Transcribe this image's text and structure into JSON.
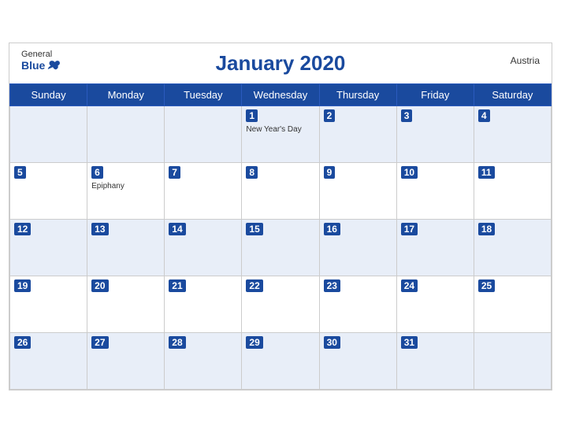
{
  "header": {
    "logo_general": "General",
    "logo_blue": "Blue",
    "title": "January 2020",
    "country": "Austria"
  },
  "days_of_week": [
    "Sunday",
    "Monday",
    "Tuesday",
    "Wednesday",
    "Thursday",
    "Friday",
    "Saturday"
  ],
  "weeks": [
    [
      {
        "day": "",
        "holiday": ""
      },
      {
        "day": "",
        "holiday": ""
      },
      {
        "day": "",
        "holiday": ""
      },
      {
        "day": "1",
        "holiday": "New Year's Day"
      },
      {
        "day": "2",
        "holiday": ""
      },
      {
        "day": "3",
        "holiday": ""
      },
      {
        "day": "4",
        "holiday": ""
      }
    ],
    [
      {
        "day": "5",
        "holiday": ""
      },
      {
        "day": "6",
        "holiday": "Epiphany"
      },
      {
        "day": "7",
        "holiday": ""
      },
      {
        "day": "8",
        "holiday": ""
      },
      {
        "day": "9",
        "holiday": ""
      },
      {
        "day": "10",
        "holiday": ""
      },
      {
        "day": "11",
        "holiday": ""
      }
    ],
    [
      {
        "day": "12",
        "holiday": ""
      },
      {
        "day": "13",
        "holiday": ""
      },
      {
        "day": "14",
        "holiday": ""
      },
      {
        "day": "15",
        "holiday": ""
      },
      {
        "day": "16",
        "holiday": ""
      },
      {
        "day": "17",
        "holiday": ""
      },
      {
        "day": "18",
        "holiday": ""
      }
    ],
    [
      {
        "day": "19",
        "holiday": ""
      },
      {
        "day": "20",
        "holiday": ""
      },
      {
        "day": "21",
        "holiday": ""
      },
      {
        "day": "22",
        "holiday": ""
      },
      {
        "day": "23",
        "holiday": ""
      },
      {
        "day": "24",
        "holiday": ""
      },
      {
        "day": "25",
        "holiday": ""
      }
    ],
    [
      {
        "day": "26",
        "holiday": ""
      },
      {
        "day": "27",
        "holiday": ""
      },
      {
        "day": "28",
        "holiday": ""
      },
      {
        "day": "29",
        "holiday": ""
      },
      {
        "day": "30",
        "holiday": ""
      },
      {
        "day": "31",
        "holiday": ""
      },
      {
        "day": "",
        "holiday": ""
      }
    ]
  ]
}
